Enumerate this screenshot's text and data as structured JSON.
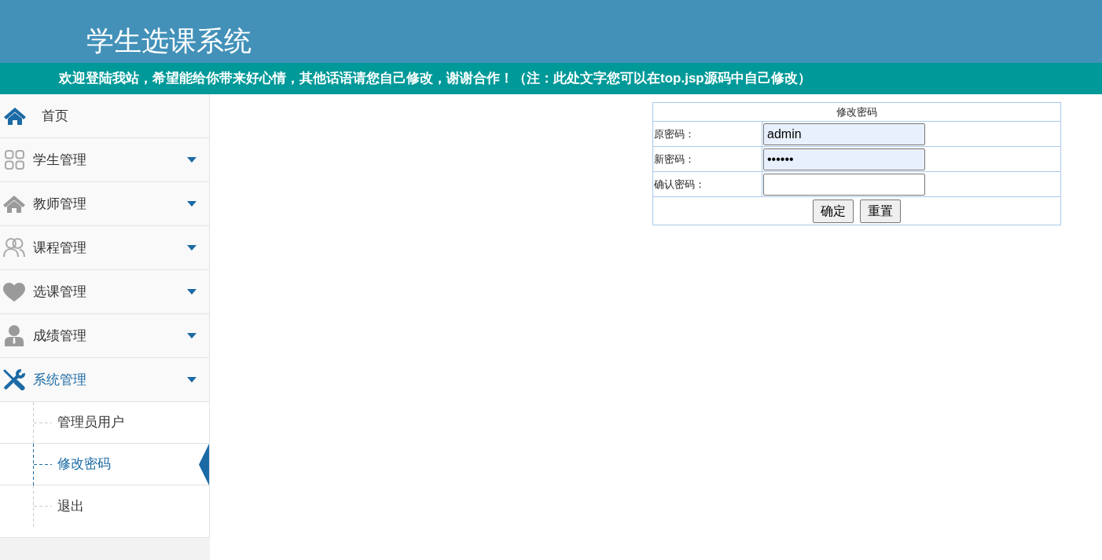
{
  "header": {
    "title": "学生选课系统"
  },
  "banner": {
    "text": "欢迎登陆我站，希望能给你带来好心情，其他话语请您自己修改，谢谢合作！（注：此处文字您可以在top.jsp源码中自己修改）"
  },
  "sidebar": {
    "items": [
      {
        "kind": "link",
        "label": "首页"
      },
      {
        "kind": "group",
        "label": "学生管理",
        "expanded": false
      },
      {
        "kind": "group",
        "label": "教师管理",
        "expanded": false
      },
      {
        "kind": "group",
        "label": "课程管理",
        "expanded": false
      },
      {
        "kind": "group",
        "label": "选课管理",
        "expanded": false
      },
      {
        "kind": "group",
        "label": "成绩管理",
        "expanded": false
      },
      {
        "kind": "group",
        "label": "系统管理",
        "expanded": true,
        "children": [
          {
            "label": "管理员用户",
            "selected": false
          },
          {
            "label": "修改密码",
            "selected": true
          },
          {
            "label": "退出",
            "selected": false
          }
        ]
      }
    ]
  },
  "form": {
    "title": "修改密码",
    "fields": [
      {
        "label": "原密码：",
        "value": "admin",
        "autofilled": true
      },
      {
        "label": "新密码：",
        "value": "••••••",
        "autofilled": true
      },
      {
        "label": "确认密码：",
        "autofilled": false
      }
    ],
    "buttons": [
      "确定",
      "重置"
    ]
  }
}
